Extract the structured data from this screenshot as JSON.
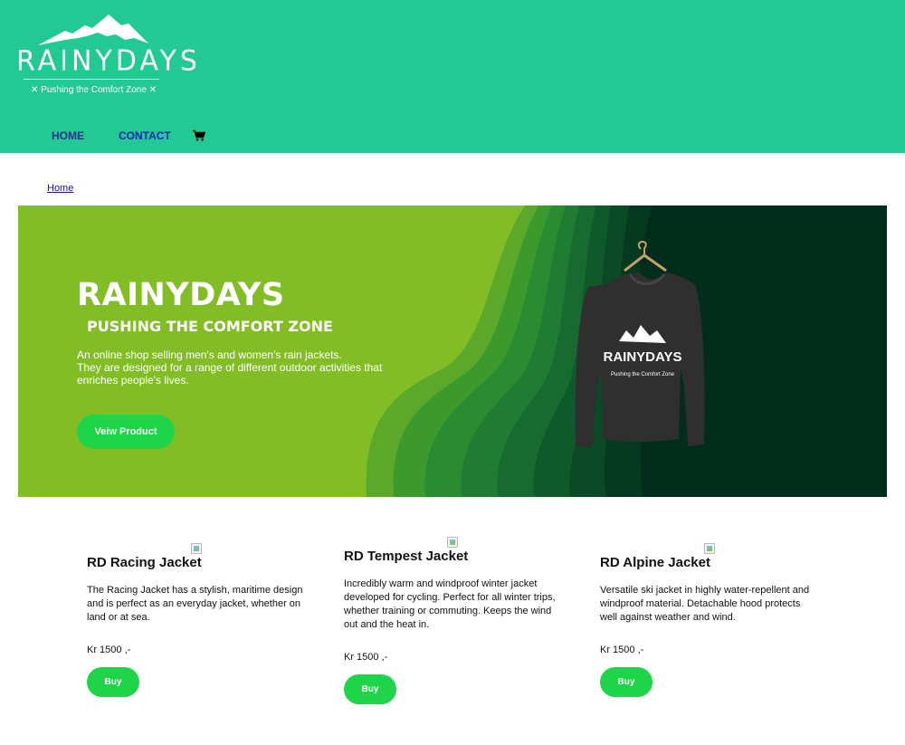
{
  "header": {
    "logo_text": "RAINYDAYS",
    "logo_tagline": "✕ Pushing the Comfort Zone ✕",
    "nav": {
      "home": "HOME",
      "contact": "CONTACT",
      "cart_icon": "shopping-cart-icon"
    },
    "colors": {
      "header_bg": "#22c993",
      "nav_link": "#1a24b8"
    }
  },
  "breadcrumb": {
    "home": "Home"
  },
  "hero": {
    "title": "RAINYDAYS",
    "subtitle": "PUSHING THE COMFORT ZONE",
    "description_lines": [
      "An online shop selling men's and women's rain jackets.",
      "They are designed for a range of different outdoor activities that",
      "enriches people's lives."
    ],
    "button_label": "Veiw Product",
    "image_shirt_text": "RAINYDAYS",
    "image_shirt_tagline": "Pushing the Comfort Zone",
    "colors": {
      "bg": "#82bd26",
      "dark": "#023020",
      "button": "#1ed448"
    }
  },
  "products": [
    {
      "name": "RD Racing Jacket",
      "description": "The Racing Jacket has a stylish, maritime design and is perfect as an everyday jacket, whether on land or at sea.",
      "price": "Kr 1500 ,-",
      "button_label": "Buy",
      "image_icon": "broken-image-icon"
    },
    {
      "name": "RD Tempest Jacket",
      "description": "Incredibly warm and windproof winter jacket developed for cycling. Perfect for all winter trips, whether training or commuting. Keeps the wind out and the heat in.",
      "price": "Kr 1500 ,-",
      "button_label": "Buy",
      "image_icon": "broken-image-icon"
    },
    {
      "name": "RD Alpine Jacket",
      "description": "Versatile ski jacket in highly water-repellent and windproof material. Detachable hood protects well against weather and wind.",
      "price": "Kr 1500 ,-",
      "button_label": "Buy",
      "image_icon": "broken-image-icon"
    }
  ]
}
